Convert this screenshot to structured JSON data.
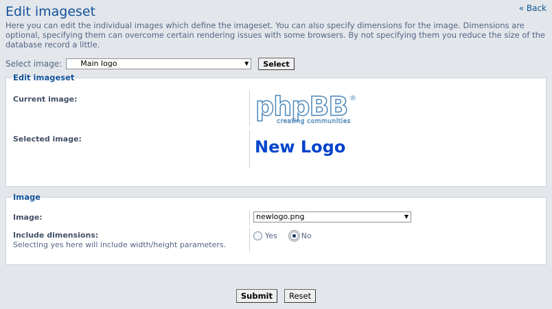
{
  "header": {
    "title": "Edit imageset",
    "back_label": "« Back",
    "intro": "Here you can edit the individual images which define the imageset. You can also specify dimensions for the image. Dimensions are optional, specifying them can overcome certain rendering issues with some browsers. By not specifying them you reduce the size of the database record a little."
  },
  "image_picker": {
    "label": "Select image:",
    "selected": "Main logo",
    "button_label": "Select"
  },
  "edit_fieldset": {
    "legend": "Edit imageset",
    "current_label": "Current image:",
    "current_logo_text": "phpBB",
    "current_logo_tagline": "creating communities",
    "current_logo_mark": "®",
    "selected_label": "Selected image:",
    "selected_preview": "New Logo"
  },
  "image_fieldset": {
    "legend": "Image",
    "image_label": "Image:",
    "image_value": "newlogo.png",
    "dimensions_label": "Include dimensions:",
    "dimensions_hint": "Selecting yes here will include width/height parameters.",
    "option_yes": "Yes",
    "option_no": "No",
    "selected_option": "No"
  },
  "actions": {
    "submit_label": "Submit",
    "reset_label": "Reset"
  },
  "colors": {
    "background": "#e3e7ec",
    "heading": "#115098",
    "panel": "#ffffff",
    "new_logo": "#0044cc"
  }
}
